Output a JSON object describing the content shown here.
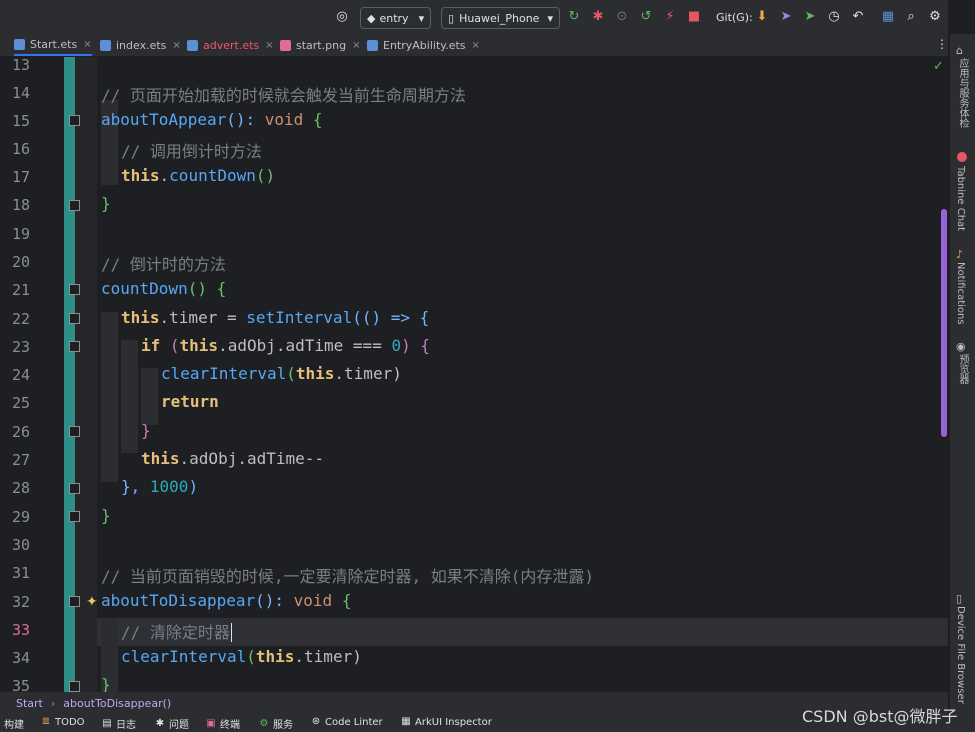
{
  "toolbar": {
    "module": "entry",
    "device": "Huawei_Phone",
    "git_label": "Git(G):"
  },
  "tabs": [
    {
      "label": "Start.ets",
      "active": true,
      "color": "#dfe1e5"
    },
    {
      "label": "index.ets",
      "color": "#dfe1e5"
    },
    {
      "label": "advert.ets",
      "color": "#f75464"
    },
    {
      "label": "start.png",
      "color": "#dfe1e5"
    },
    {
      "label": "EntryAbility.ets",
      "color": "#dfe1e5"
    }
  ],
  "tab_close": "×",
  "line_numbers": [
    "13",
    "14",
    "15",
    "16",
    "17",
    "18",
    "19",
    "20",
    "21",
    "22",
    "23",
    "24",
    "25",
    "26",
    "27",
    "28",
    "29",
    "30",
    "31",
    "32",
    "33",
    "34",
    "35"
  ],
  "current_line": "33",
  "code": {
    "l14": "// 页面开始加载的时候就会触发当前生命周期方法",
    "l15_fn": "aboutToAppear",
    "l15_rest": "(): ",
    "l15_kw": "void",
    "l15_br": " {",
    "l16": "// 调用倒计时方法",
    "l17_this": "this",
    "l17_rest": ".",
    "l17_fn": "countDown",
    "l17_p": "()",
    "l18": "}",
    "l20": "// 倒计时的方法",
    "l21_fn": "countDown",
    "l21_rest": "() {",
    "l22_this": "this",
    "l22_a": ".timer = ",
    "l22_fn": "setInterval",
    "l22_b": "(() => {",
    "l23_kw": "if",
    "l23_a": " (",
    "l23_this": "this",
    "l23_b": ".adObj.adTime === ",
    "l23_num": "0",
    "l23_c": ") {",
    "l24_fn": "clearInterval",
    "l24_a": "(",
    "l24_this": "this",
    "l24_b": ".timer)",
    "l25": "return",
    "l26": "}",
    "l27_this": "this",
    "l27_rest": ".adObj.adTime--",
    "l28_a": "}, ",
    "l28_num": "1000",
    "l28_b": ")",
    "l29": "}",
    "l31": "// 当前页面销毁的时候,一定要清除定时器, 如果不清除(内存泄露)",
    "l32_fn": "aboutToDisappear",
    "l32_rest": "(): ",
    "l32_kw": "void",
    "l32_br": " {",
    "l33": "// 清除定时器",
    "l34_fn": "clearInterval",
    "l34_a": "(",
    "l34_this": "this",
    "l34_b": ".timer)",
    "l35": "}"
  },
  "right_panel": [
    "应用与服务体检",
    "Tabnine Chat",
    "Notifications",
    "预览器",
    "Device File Browser"
  ],
  "breadcrumb": {
    "item1": "Start",
    "sep": "›",
    "item2": "aboutToDisappear()"
  },
  "status": [
    {
      "label": "构建"
    },
    {
      "label": "TODO"
    },
    {
      "label": "日志"
    },
    {
      "label": "问题"
    },
    {
      "label": "终端"
    },
    {
      "label": "服务"
    },
    {
      "label": "Code Linter"
    },
    {
      "label": "ArkUI Inspector"
    }
  ],
  "watermark": "CSDN @bst@微胖子",
  "check_mark": "✓"
}
